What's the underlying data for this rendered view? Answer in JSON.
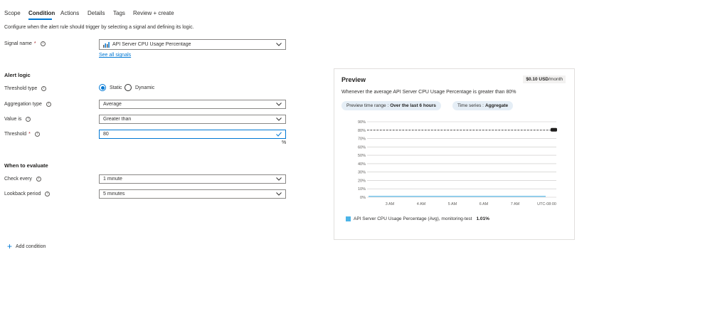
{
  "tabs": [
    {
      "label": "Scope"
    },
    {
      "label": "Condition"
    },
    {
      "label": "Actions"
    },
    {
      "label": "Details"
    },
    {
      "label": "Tags"
    },
    {
      "label": "Review + create"
    }
  ],
  "description": "Configure when the alert rule should trigger by selecting a signal and defining its logic.",
  "signal": {
    "label": "Signal name",
    "value": "API Server CPU Usage Percentage",
    "see_all": "See all signals"
  },
  "alert_logic": {
    "heading": "Alert logic",
    "threshold_type_label": "Threshold type",
    "static_label": "Static",
    "dynamic_label": "Dynamic",
    "aggregation_label": "Aggregation type",
    "aggregation_value": "Average",
    "value_is_label": "Value is",
    "value_is_value": "Greater than",
    "threshold_label": "Threshold",
    "threshold_value": "80",
    "threshold_unit": "%"
  },
  "evaluate": {
    "heading": "When to evaluate",
    "check_every_label": "Check every",
    "check_every_value": "1 minute",
    "lookback_label": "Lookback period",
    "lookback_value": "5 minutes"
  },
  "add_condition": "Add condition",
  "preview": {
    "title": "Preview",
    "cost_amount": "$0.10 USD",
    "cost_period": "/month",
    "description": "Whenever the average API Server CPU Usage Percentage is greater than 80%",
    "time_range_label": "Preview time range :",
    "time_range_value": "Over the last 6 hours",
    "time_series_label": "Time series :",
    "time_series_value": "Aggregate",
    "legend_label": "API Server CPU Usage Percentage (Avg), monitoring-test",
    "legend_value": "1.01%",
    "timezone": "UTC-08:00"
  },
  "chart_data": {
    "type": "line",
    "y_ticks": [
      "0%",
      "10%",
      "20%",
      "30%",
      "40%",
      "50%",
      "60%",
      "70%",
      "80%",
      "90%"
    ],
    "x_ticks": [
      "3 AM",
      "4 AM",
      "5 AM",
      "6 AM",
      "7 AM"
    ],
    "ylim": [
      0,
      90
    ],
    "threshold": 80,
    "series": [
      {
        "name": "API Server CPU Usage Percentage (Avg), monitoring-test",
        "values": [
          1,
          1,
          1,
          1,
          1,
          1,
          1,
          1,
          1,
          1,
          1,
          1,
          1,
          1,
          1,
          1,
          1
        ]
      }
    ],
    "colors": {
      "series": "#4cb4e7",
      "threshold": "#323130"
    }
  }
}
